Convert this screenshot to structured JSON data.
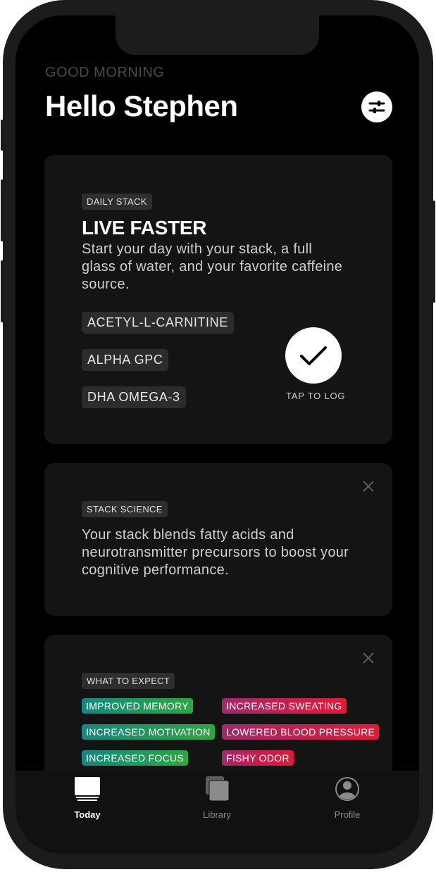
{
  "header": {
    "greeting": "GOOD MORNING",
    "hello": "Hello Stephen",
    "settings_icon": "sliders-icon"
  },
  "daily_stack": {
    "badge": "DAILY STACK",
    "title": "LIVE FASTER",
    "description": "Start your day with your stack, a full glass of water, and your favorite caffeine source.",
    "ingredients": [
      "ACETYL-L-CARNITINE",
      "ALPHA GPC",
      "DHA OMEGA-3"
    ],
    "log_label": "TAP TO LOG",
    "log_icon": "checkmark-icon"
  },
  "stack_science": {
    "badge": "STACK SCIENCE",
    "text": "Your stack blends fatty acids and neurotransmitter precursors to boost your cognitive performance.",
    "close_icon": "close-icon"
  },
  "what_to_expect": {
    "badge": "WHAT TO EXPECT",
    "positive": [
      "IMPROVED MEMORY",
      "INCREASED MOTIVATION",
      "INCREASED FOCUS"
    ],
    "negative": [
      "INCREASED SWEATING",
      "LOWERED BLOOD PRESSURE",
      "FISHY ODOR"
    ],
    "close_icon": "close-icon"
  },
  "tabbar": {
    "tabs": [
      {
        "label": "Today",
        "icon": "today-icon",
        "active": true
      },
      {
        "label": "Library",
        "icon": "library-icon",
        "active": false
      },
      {
        "label": "Profile",
        "icon": "profile-icon",
        "active": false
      }
    ]
  },
  "colors": {
    "background": "#000000",
    "card": "#141414",
    "positive_gradient": [
      "#16877f",
      "#2ea642"
    ],
    "negative_gradient": [
      "#9f2a6a",
      "#e21938"
    ]
  }
}
